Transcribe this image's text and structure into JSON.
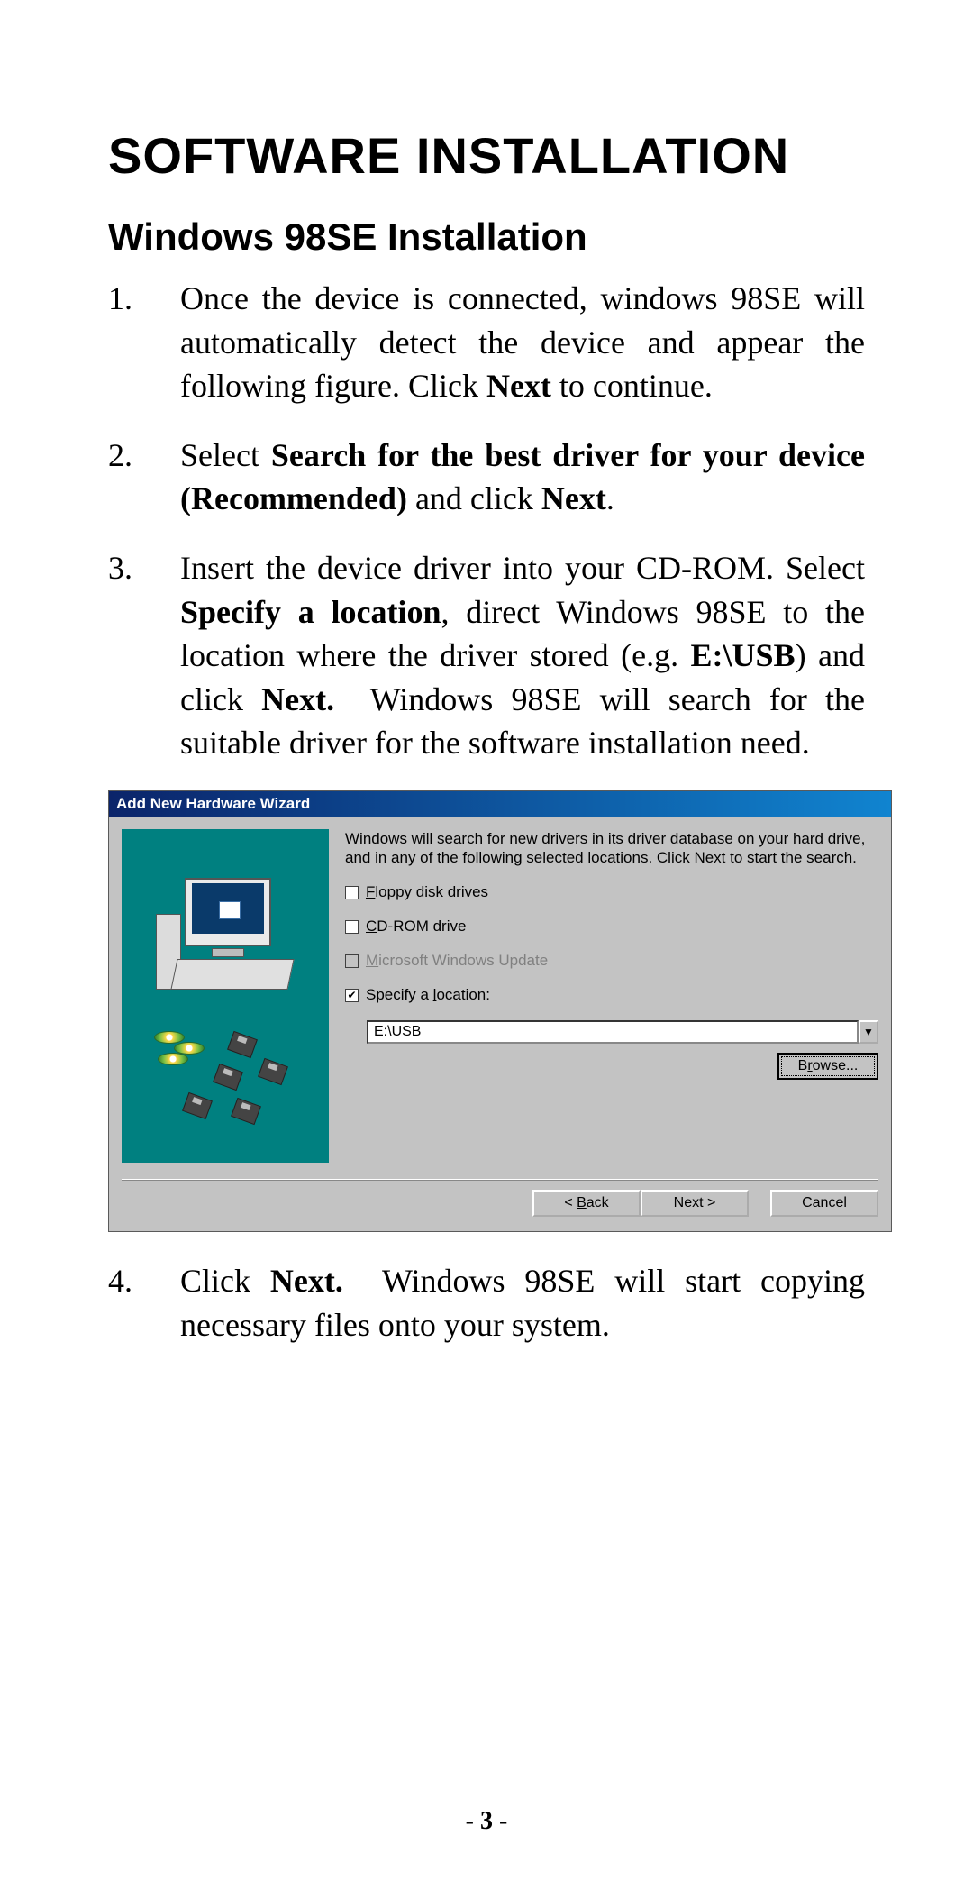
{
  "doc": {
    "main_title": "SOFTWARE INSTALLATION",
    "sub_title": "Windows 98SE Installation",
    "page_number": "- 3 -",
    "steps": [
      {
        "num": "1.",
        "html": "Once the device is connected, windows 98SE will automatically detect the device and appear the following figure. Click <b>Next</b> to continue."
      },
      {
        "num": "2.",
        "html": "Select <b>Search for the best driver for your device (Recommended)</b> and click <b>Next</b>."
      },
      {
        "num": "3.",
        "html": "Insert the device driver into your CD-ROM. Select <b>Specify a location</b>, direct Windows 98SE to the location where the driver stored (e.g. <b>E:\\USB</b>) and click <b>Next.</b>&nbsp; Windows 98SE will search for the suitable driver for the software installation need."
      },
      {
        "num": "4.",
        "html": "Click <b>Next.</b>&nbsp; Windows 98SE will start copying necessary files onto your system."
      }
    ]
  },
  "wizard": {
    "title": "Add New Hardware Wizard",
    "desc": "Windows will search for new drivers in its driver database on your hard drive, and in any of the following selected locations. Click Next to start the search.",
    "checks": {
      "floppy": {
        "text": "Floppy disk drives",
        "u": "F",
        "checked": false,
        "disabled": false
      },
      "cdrom": {
        "text": "CD-ROM drive",
        "u": "C",
        "checked": false,
        "disabled": false
      },
      "msupdate": {
        "text": "Microsoft Windows Update",
        "u": "M",
        "checked": false,
        "disabled": true
      },
      "specify": {
        "text": "Specify a location:",
        "u": "l",
        "checked": true,
        "disabled": false
      }
    },
    "location_value": "E:\\USB",
    "buttons": {
      "browse": "Browse...",
      "back": "< Back",
      "next": "Next >",
      "cancel": "Cancel"
    },
    "underline": {
      "browse": "r",
      "back": "B"
    }
  }
}
